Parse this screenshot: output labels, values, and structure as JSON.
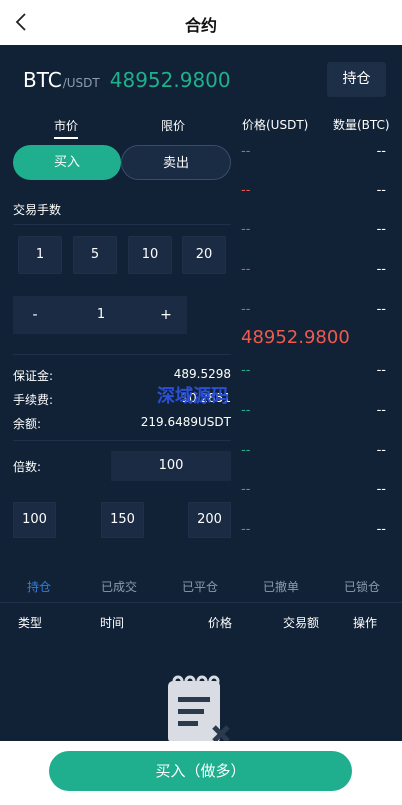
{
  "header": {
    "title": "合约"
  },
  "pair": {
    "base": "BTC",
    "quote": "/USDT",
    "price": "48952.9800"
  },
  "hold_label": "持仓",
  "order_types": {
    "market": "市价",
    "limit": "限价"
  },
  "sides": {
    "buy": "买入",
    "sell": "卖出"
  },
  "quantity": {
    "label": "交易手数",
    "presets": [
      "1",
      "5",
      "10",
      "20"
    ],
    "minus": "-",
    "value": "1",
    "plus": "+"
  },
  "info": {
    "margin_label": "保证金:",
    "margin_value": "489.5298",
    "fee_label": "手续费:",
    "fee_value": "10.2851",
    "balance_label": "余额:",
    "balance_value": "219.6489USDT"
  },
  "leverage": {
    "label": "倍数:",
    "value": "100",
    "options": [
      "100",
      "150",
      "200"
    ]
  },
  "orderbook": {
    "price_header": "价格(USDT)",
    "qty_header": "数量(BTC)",
    "asks": [
      {
        "price": "--",
        "qty": "--"
      },
      {
        "price": "--",
        "qty": "--"
      },
      {
        "price": "--",
        "qty": "--"
      },
      {
        "price": "--",
        "qty": "--"
      },
      {
        "price": "--",
        "qty": "--"
      }
    ],
    "last_price": "48952.9800",
    "bids": [
      {
        "price": "--",
        "qty": "--"
      },
      {
        "price": "--",
        "qty": "--"
      },
      {
        "price": "--",
        "qty": "--"
      },
      {
        "price": "--",
        "qty": "--"
      },
      {
        "price": "--",
        "qty": "--"
      }
    ]
  },
  "watermark": "深域源码",
  "tabs": [
    "持仓",
    "已成交",
    "已平仓",
    "已撤单",
    "已锁仓"
  ],
  "table_headers": [
    "类型",
    "时间",
    "价格",
    "交易额",
    "操作"
  ],
  "bottom_button": "买入（做多）",
  "colors": {
    "background": "#112236",
    "accent_green": "#1fae8e",
    "ask_red": "#e65548",
    "active_tab": "#2f7fe0"
  }
}
